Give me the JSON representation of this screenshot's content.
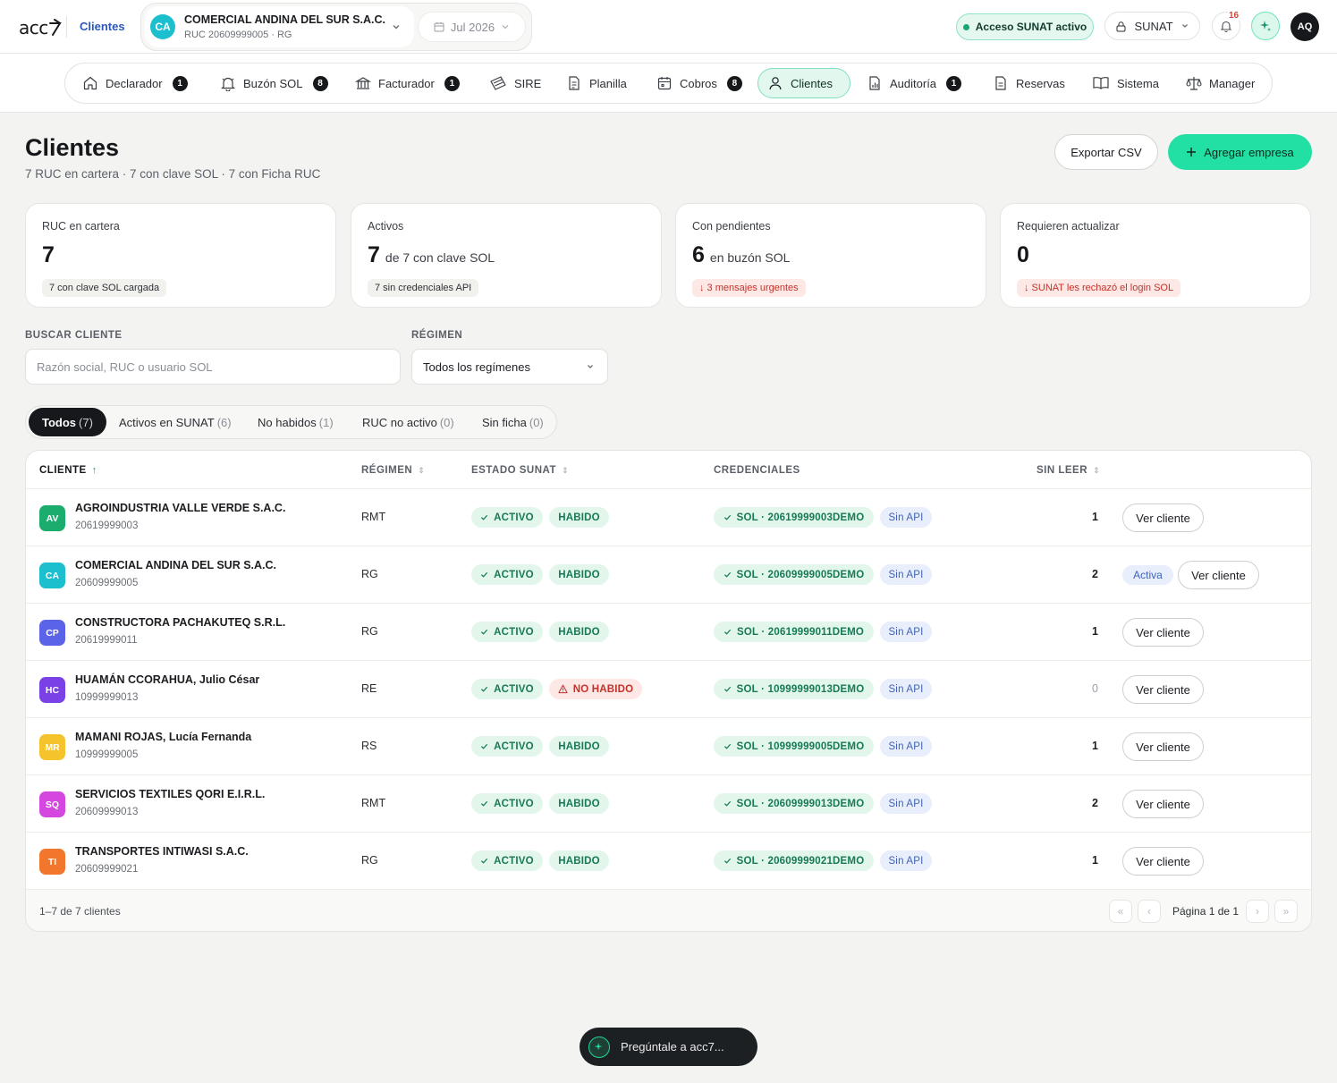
{
  "header": {
    "logo_text": "acc7",
    "breadcrumb": "Clientes",
    "company": {
      "initials": "CA",
      "name": "COMERCIAL ANDINA DEL SUR S.A.C.",
      "ruc_line": "RUC 20609999005 · RG"
    },
    "period": "Jul 2026",
    "sunat_access": "Acceso SUNAT activo",
    "sunat_button": "SUNAT",
    "notifications_count": "16",
    "user_initials": "AQ"
  },
  "nav": [
    {
      "label": "Declarador",
      "badge": "1",
      "icon": "home-icon"
    },
    {
      "label": "Buzón SOL",
      "badge": "8",
      "icon": "bell-icon"
    },
    {
      "label": "Facturador",
      "badge": "1",
      "icon": "building-icon"
    },
    {
      "label": "SIRE",
      "badge": "",
      "icon": "ticket-icon"
    },
    {
      "label": "Planilla",
      "badge": "",
      "icon": "document-icon"
    },
    {
      "label": "Cobros",
      "badge": "8",
      "icon": "calendar-icon"
    },
    {
      "label": "Clientes",
      "badge": "",
      "icon": "user-icon",
      "active": true
    },
    {
      "label": "Auditoría",
      "badge": "1",
      "icon": "chart-doc-icon"
    },
    {
      "label": "Reservas",
      "badge": "",
      "icon": "page-icon"
    },
    {
      "label": "Sistema",
      "badge": "",
      "icon": "book-icon"
    },
    {
      "label": "Manager",
      "badge": "",
      "icon": "scale-icon"
    }
  ],
  "page": {
    "title": "Clientes",
    "subtitle": "7 RUC en cartera · 7 con clave SOL · 7 con Ficha RUC",
    "export_label": "Exportar CSV",
    "add_label": "Agregar empresa"
  },
  "kpis": [
    {
      "label": "RUC en cartera",
      "value": "7",
      "rest": "",
      "chip": "7 con clave SOL cargada",
      "chip_red": false
    },
    {
      "label": "Activos",
      "value": "7",
      "rest": "de 7 con clave SOL",
      "chip": "7 sin credenciales API",
      "chip_red": false
    },
    {
      "label": "Con pendientes",
      "value": "6",
      "rest": "en buzón SOL",
      "chip": "↓ 3 mensajes urgentes",
      "chip_red": true
    },
    {
      "label": "Requieren actualizar",
      "value": "0",
      "rest": "",
      "chip": "↓ SUNAT les rechazó el login SOL",
      "chip_red": true
    }
  ],
  "filters": {
    "search_label": "BUSCAR CLIENTE",
    "search_placeholder": "Razón social, RUC o usuario SOL",
    "regime_label": "RÉGIMEN",
    "regime_value": "Todos los regímenes"
  },
  "tabs": [
    {
      "label": "Todos",
      "count": "(7)"
    },
    {
      "label": "Activos en SUNAT",
      "count": "(6)"
    },
    {
      "label": "No habidos",
      "count": "(1)"
    },
    {
      "label": "RUC no activo",
      "count": "(0)"
    },
    {
      "label": "Sin ficha",
      "count": "(0)"
    }
  ],
  "table": {
    "headers": {
      "client": "CLIENTE",
      "regime": "RÉGIMEN",
      "status": "ESTADO SUNAT",
      "credentials": "CREDENCIALES",
      "unread": "SIN LEER"
    },
    "rows": [
      {
        "initials": "AV",
        "color": "#1aad6e",
        "name": "AGROINDUSTRIA VALLE VERDE S.A.C.",
        "ruc": "20619999003",
        "regime": "RMT",
        "status": "ACTIVO",
        "habido": "HABIDO",
        "habido_ok": true,
        "sol": "SOL · 20619999003DEMO",
        "api": "Sin API",
        "unread": "1",
        "activa": ""
      },
      {
        "initials": "CA",
        "color": "#1bbfce",
        "name": "COMERCIAL ANDINA DEL SUR S.A.C.",
        "ruc": "20609999005",
        "regime": "RG",
        "status": "ACTIVO",
        "habido": "HABIDO",
        "habido_ok": true,
        "sol": "SOL · 20609999005DEMO",
        "api": "Sin API",
        "unread": "2",
        "activa": "Activa"
      },
      {
        "initials": "CP",
        "color": "#5b63e8",
        "name": "CONSTRUCTORA PACHAKUTEQ S.R.L.",
        "ruc": "20619999011",
        "regime": "RG",
        "status": "ACTIVO",
        "habido": "HABIDO",
        "habido_ok": true,
        "sol": "SOL · 20619999011DEMO",
        "api": "Sin API",
        "unread": "1",
        "activa": ""
      },
      {
        "initials": "HC",
        "color": "#7a42e6",
        "name": "HUAMÁN CCORAHUA, Julio César",
        "ruc": "10999999013",
        "regime": "RE",
        "status": "ACTIVO",
        "habido": "NO HABIDO",
        "habido_ok": false,
        "sol": "SOL · 10999999013DEMO",
        "api": "Sin API",
        "unread": "0",
        "activa": ""
      },
      {
        "initials": "MR",
        "color": "#f5c32c",
        "name": "MAMANI ROJAS, Lucía Fernanda",
        "ruc": "10999999005",
        "regime": "RS",
        "status": "ACTIVO",
        "habido": "HABIDO",
        "habido_ok": true,
        "sol": "SOL · 10999999005DEMO",
        "api": "Sin API",
        "unread": "1",
        "activa": ""
      },
      {
        "initials": "SQ",
        "color": "#d548e0",
        "name": "SERVICIOS TEXTILES QORI E.I.R.L.",
        "ruc": "20609999013",
        "regime": "RMT",
        "status": "ACTIVO",
        "habido": "HABIDO",
        "habido_ok": true,
        "sol": "SOL · 20609999013DEMO",
        "api": "Sin API",
        "unread": "2",
        "activa": ""
      },
      {
        "initials": "TI",
        "color": "#f2762b",
        "name": "TRANSPORTES INTIWASI S.A.C.",
        "ruc": "20609999021",
        "regime": "RG",
        "status": "ACTIVO",
        "habido": "HABIDO",
        "habido_ok": true,
        "sol": "SOL · 20609999021DEMO",
        "api": "Sin API",
        "unread": "1",
        "activa": ""
      }
    ],
    "view_label": "Ver cliente",
    "footer": "1–7 de 7 clientes",
    "page_label": "Página 1 de 1"
  },
  "assistant": {
    "label": "Pregúntale a acc7..."
  }
}
